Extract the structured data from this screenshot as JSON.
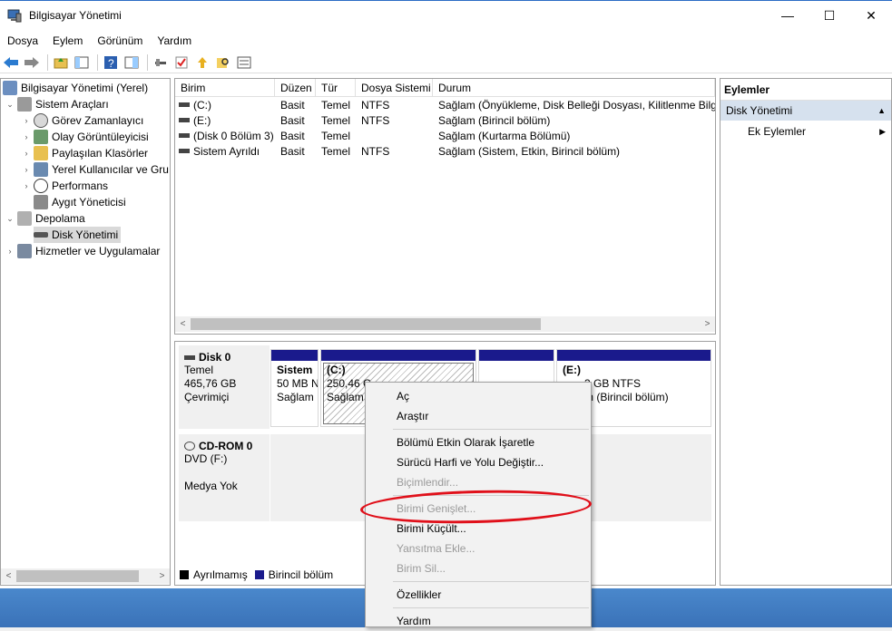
{
  "window": {
    "title": "Bilgisayar Yönetimi",
    "minimize": "—",
    "maximize": "☐",
    "close": "✕"
  },
  "menu": [
    "Dosya",
    "Eylem",
    "Görünüm",
    "Yardım"
  ],
  "tree": {
    "root": "Bilgisayar Yönetimi (Yerel)",
    "items": [
      {
        "label": "Sistem Araçları"
      },
      {
        "label": "Görev Zamanlayıcı"
      },
      {
        "label": "Olay Görüntüleyicisi"
      },
      {
        "label": "Paylaşılan Klasörler"
      },
      {
        "label": "Yerel Kullanıcılar ve Gru"
      },
      {
        "label": "Performans"
      },
      {
        "label": "Aygıt Yöneticisi"
      },
      {
        "label": "Depolama"
      },
      {
        "label": "Disk Yönetimi"
      },
      {
        "label": "Hizmetler ve Uygulamalar"
      }
    ]
  },
  "volumes": {
    "headers": [
      "Birim",
      "Düzen",
      "Tür",
      "Dosya Sistemi",
      "Durum"
    ],
    "rows": [
      {
        "name": "(C:)",
        "layout": "Basit",
        "type": "Temel",
        "fs": "NTFS",
        "status": "Sağlam (Önyükleme, Disk Belleği Dosyası, Kilitlenme Bilgis"
      },
      {
        "name": "(E:)",
        "layout": "Basit",
        "type": "Temel",
        "fs": "NTFS",
        "status": "Sağlam (Birincil bölüm)"
      },
      {
        "name": "(Disk 0 Bölüm 3)",
        "layout": "Basit",
        "type": "Temel",
        "fs": "",
        "status": "Sağlam (Kurtarma Bölümü)"
      },
      {
        "name": "Sistem Ayrıldı",
        "layout": "Basit",
        "type": "Temel",
        "fs": "NTFS",
        "status": "Sağlam (Sistem, Etkin, Birincil bölüm)"
      }
    ]
  },
  "disks": {
    "disk0": {
      "name": "Disk 0",
      "kind": "Temel",
      "size": "465,76 GB",
      "state": "Çevrimiçi"
    },
    "cdrom": {
      "name": "CD-ROM 0",
      "kind": "DVD (F:)",
      "state": "Medya Yok"
    },
    "parts": {
      "sys": {
        "name": "Sistem",
        "size": "50 MB N",
        "status": "Sağlam"
      },
      "c": {
        "name": "(C:)",
        "size": "250,46 G",
        "status": "Sağlam"
      },
      "e": {
        "name": "(E:)",
        "size": "3 GB NTFS",
        "status": "m (Birincil bölüm)"
      }
    }
  },
  "legend": {
    "unallocated": "Ayrılmamış",
    "primary": "Birincil bölüm"
  },
  "actions": {
    "header": "Eylemler",
    "section": "Disk Yönetimi",
    "more": "Ek Eylemler"
  },
  "context_menu": {
    "open": "Aç",
    "explore": "Araştır",
    "mark_active": "Bölümü Etkin Olarak İşaretle",
    "change_letter": "Sürücü Harfi ve Yolu Değiştir...",
    "format": "Biçimlendir...",
    "extend": "Birimi Genişlet...",
    "shrink": "Birimi Küçült...",
    "mirror": "Yansıtma Ekle...",
    "delete": "Birim Sil...",
    "properties": "Özellikler",
    "help": "Yardım"
  },
  "colors": {
    "primary_partition": "#1a1a8c",
    "unallocated": "#000000",
    "annotation": "#e0101a"
  }
}
